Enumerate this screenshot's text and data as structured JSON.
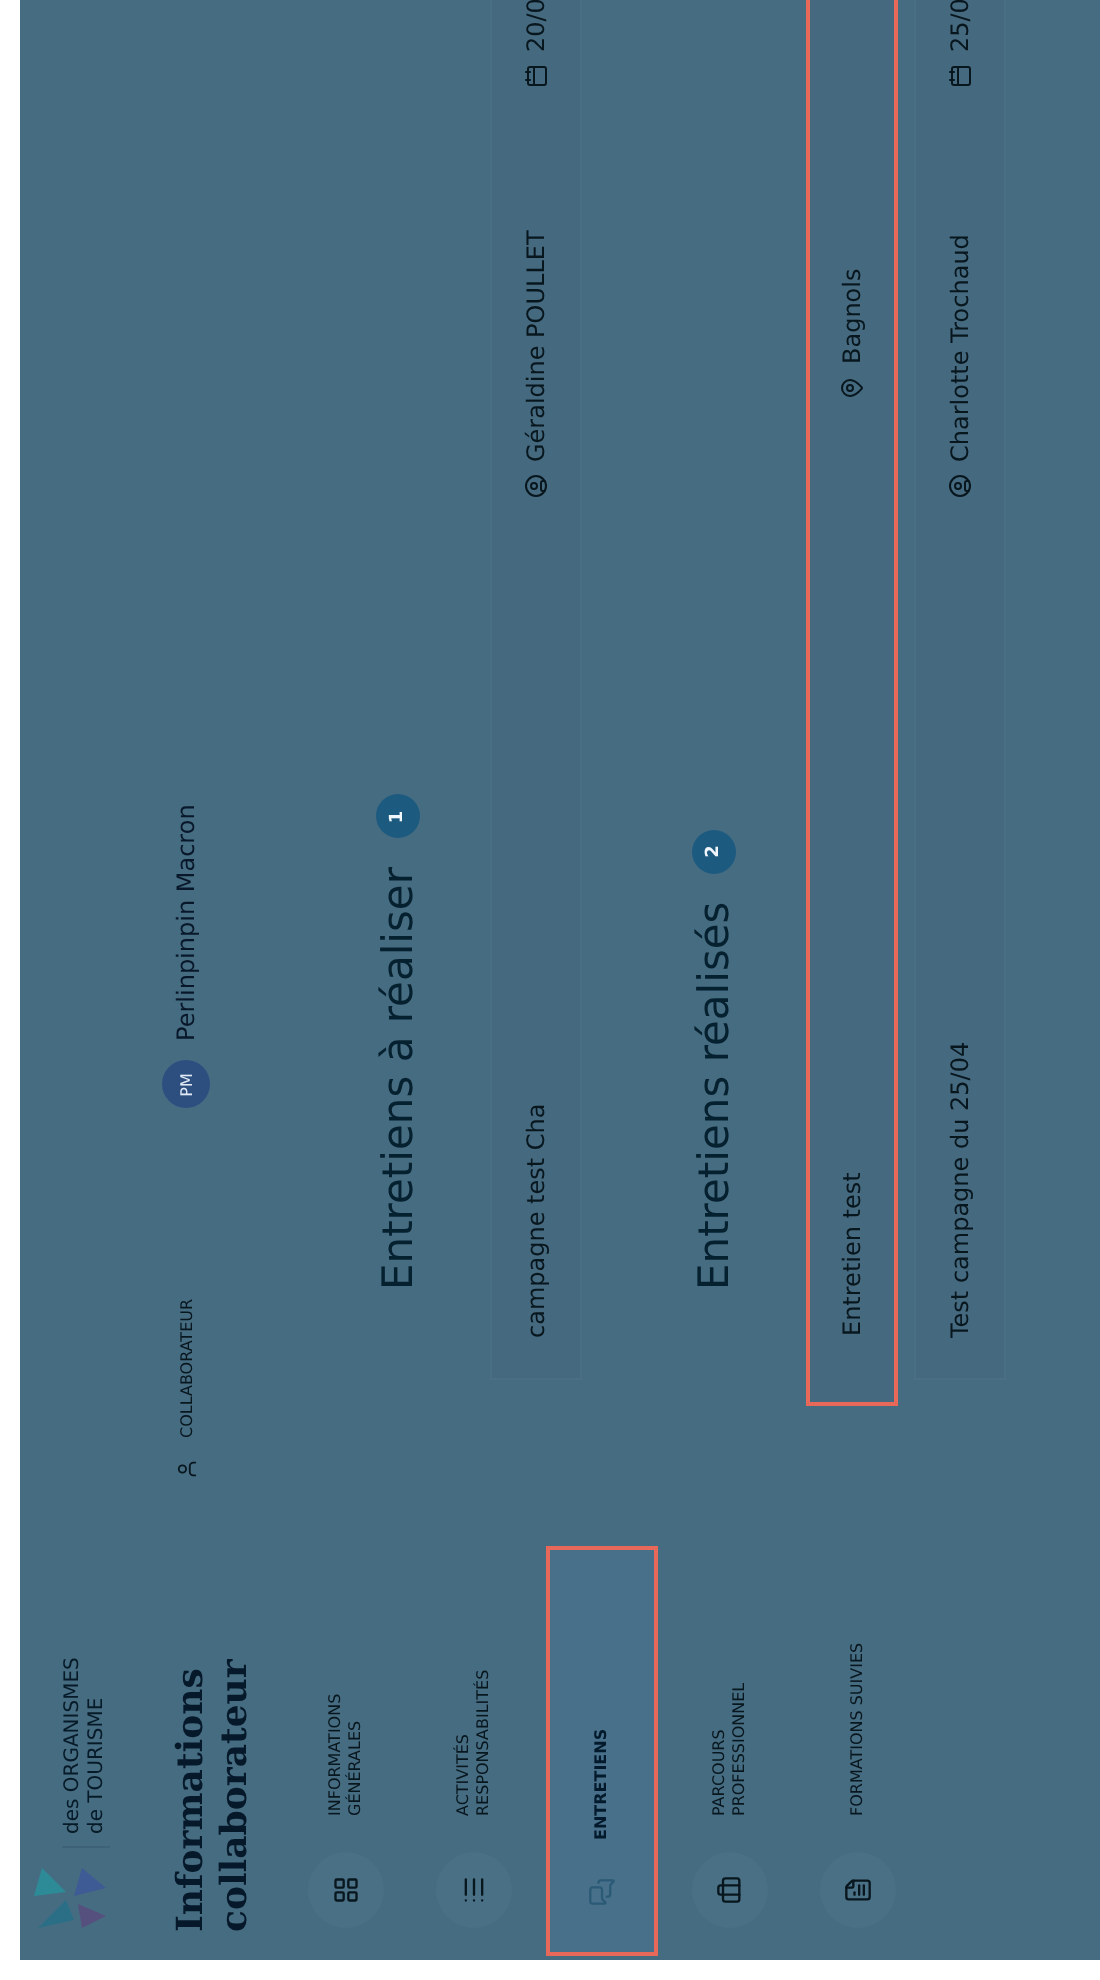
{
  "logo": {
    "lines": [
      "des ORGANISMES",
      "de TOURISME"
    ]
  },
  "sidebar": {
    "title": "Informations collaborateur",
    "items": [
      {
        "label": "INFORMATIONS GÉNÉRALES",
        "kind": "grid",
        "selected": false,
        "highlighted": false
      },
      {
        "label": "ACTIVITÉS RESPONSABILITÉS",
        "kind": "list",
        "selected": false,
        "highlighted": false
      },
      {
        "label": "ENTRETIENS",
        "kind": "chat",
        "selected": true,
        "highlighted": true
      },
      {
        "label": "PARCOURS PROFESSIONNEL",
        "kind": "briefcase",
        "selected": false,
        "highlighted": false
      },
      {
        "label": "FORMATIONS SUIVIES",
        "kind": "file",
        "selected": false,
        "highlighted": false
      }
    ]
  },
  "header": {
    "role": "COLLABORATEUR",
    "avatar": "PM",
    "name": "Perlinpinpin Macron"
  },
  "sections": [
    {
      "title": "Entretiens à réaliser",
      "count": "1",
      "rows": [
        {
          "title": "campagne test Cha",
          "kind": "person",
          "person": "Géraldine POULLET",
          "date": "20/0",
          "highlighted": false
        }
      ]
    },
    {
      "title": "Entretiens réalisés",
      "count": "2",
      "rows": [
        {
          "title": "Entretien test",
          "kind": "place",
          "place": "Bagnols",
          "highlighted": true
        },
        {
          "title": "Test campagne du 25/04",
          "kind": "person",
          "person": "Charlotte Trochaud",
          "date": "25/0",
          "highlighted": false
        }
      ]
    }
  ]
}
